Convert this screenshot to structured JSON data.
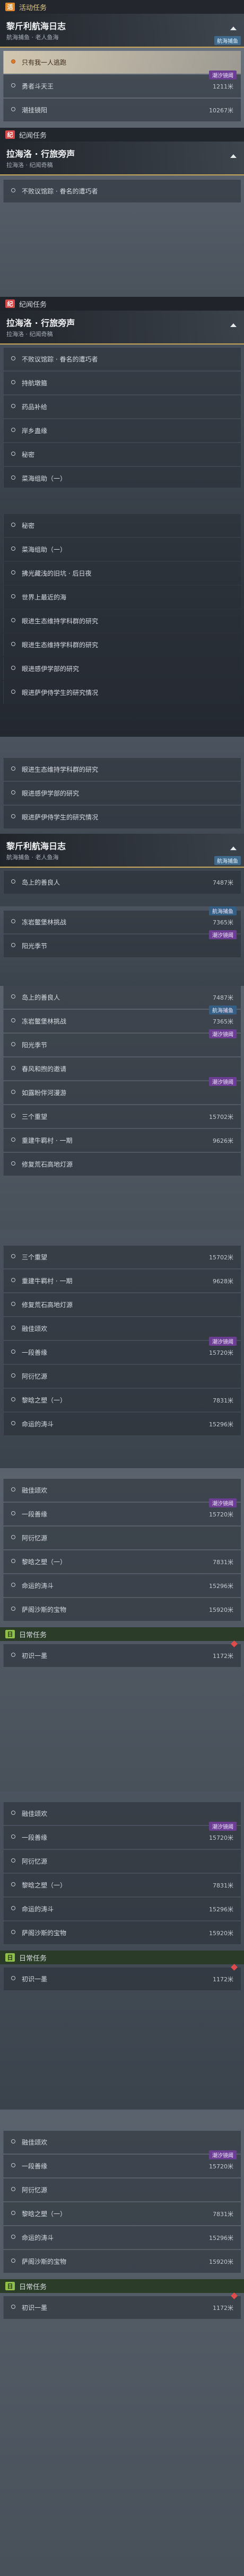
{
  "sections": {
    "active": "活动任务",
    "chronicle": "纪闻任务",
    "daily": "日常任务"
  },
  "quest1": {
    "title": "黎斤利航海日志",
    "subtitle": "航海捕鱼 · 老人鱼海",
    "tag": "航海捕鱼"
  },
  "quest2": {
    "title": "拉海洛 · 行旅旁声",
    "subtitle": "拉海洛 · 纪闻奇稿"
  },
  "tags": {
    "fishing": "航海捕鱼",
    "mirage": "潮汐镜阈",
    "nav": "潮汐镜阈"
  },
  "rows_a": [
    {
      "label": "只有我一人逃跑",
      "distance": ""
    },
    {
      "label": "勇者斗天王",
      "distance": "1211米"
    },
    {
      "label": "潮挂镜阳",
      "distance": "10267米"
    }
  ],
  "rows_b": [
    {
      "label": "不败议馆踪 · 眷名的遭巧者",
      "distance": ""
    }
  ],
  "rows_c": [
    {
      "label": "不败议馆踪 · 眷名的遭巧者"
    },
    {
      "label": "持航墩箍"
    },
    {
      "label": "药品补给"
    },
    {
      "label": "岸乡蛊缘"
    },
    {
      "label": "秘密"
    },
    {
      "label": "菜海组助（一）"
    }
  ],
  "rows_d": [
    {
      "label": "秘密"
    },
    {
      "label": "菜海组助（一）"
    },
    {
      "label": "拂光藏浅的旧坑 · 后日夜"
    },
    {
      "label": "世界上最近的海"
    },
    {
      "label": "眼进生态维持学科群的研究"
    },
    {
      "label": "眼进生态维持学科群的研究"
    },
    {
      "label": "眼进感伊学部的研究"
    },
    {
      "label": "眼进萨伊侍学生的研究情况"
    }
  ],
  "rows_e": [
    {
      "label": "眼进生态维持学科群的研究"
    },
    {
      "label": "眼进感伊学部的研究"
    },
    {
      "label": "眼进萨伊侍学生的研究情况"
    }
  ],
  "rows_f": [
    {
      "label": "岛上的善良人",
      "distance": "7487米"
    },
    {
      "label": "冻岩鳖堡林挑战",
      "distance": "7365米"
    },
    {
      "label": "阳光季节",
      "distance": ""
    }
  ],
  "rows_g": [
    {
      "label": "岛上的善良人",
      "distance": "7487米"
    },
    {
      "label": "冻岩鳖堡林挑战",
      "distance": "7365米"
    },
    {
      "label": "阳光季节",
      "distance": ""
    },
    {
      "label": "春风和煦的邀请",
      "distance": ""
    },
    {
      "label": "如露盼伴河漫游",
      "distance": ""
    },
    {
      "label": "三个重望",
      "distance": "15702米"
    },
    {
      "label": "重建牛羁村 · 一期",
      "distance": "9626米"
    },
    {
      "label": "修复荒石高地灯源",
      "distance": ""
    }
  ],
  "rows_h": [
    {
      "label": "三个重望",
      "distance": "15702米"
    },
    {
      "label": "重建牛羁村 · 一期",
      "distance": "9628米"
    },
    {
      "label": "修复荒石高地灯源",
      "distance": ""
    },
    {
      "label": "融佳颂欢",
      "distance": ""
    },
    {
      "label": "一段善缘",
      "distance": "15720米"
    },
    {
      "label": "阿衍忆源",
      "distance": ""
    },
    {
      "label": "黎晗之塑（一）",
      "distance": "7831米"
    },
    {
      "label": "命运的涛斗",
      "distance": "15296米"
    }
  ],
  "rows_i": [
    {
      "label": "融佳颂欢",
      "distance": ""
    },
    {
      "label": "一段善缘",
      "distance": "15720米"
    },
    {
      "label": "阿衍忆源",
      "distance": ""
    },
    {
      "label": "黎晗之塑（一）",
      "distance": "7831米"
    },
    {
      "label": "命运的涛斗",
      "distance": "15296米"
    },
    {
      "label": "萨阁沙斯的宝物",
      "distance": "15920米"
    }
  ],
  "daily_row": {
    "label": "初识一墨",
    "distance": "1172米"
  },
  "rows_j": [
    {
      "label": "融佳颂欢",
      "distance": ""
    },
    {
      "label": "一段善缘",
      "distance": "15720米"
    },
    {
      "label": "阿衍忆源",
      "distance": ""
    },
    {
      "label": "黎晗之塑（一）",
      "distance": "7831米"
    },
    {
      "label": "命运的涛斗",
      "distance": "15296米"
    },
    {
      "label": "萨阁沙斯的宝物",
      "distance": "15920米"
    }
  ]
}
